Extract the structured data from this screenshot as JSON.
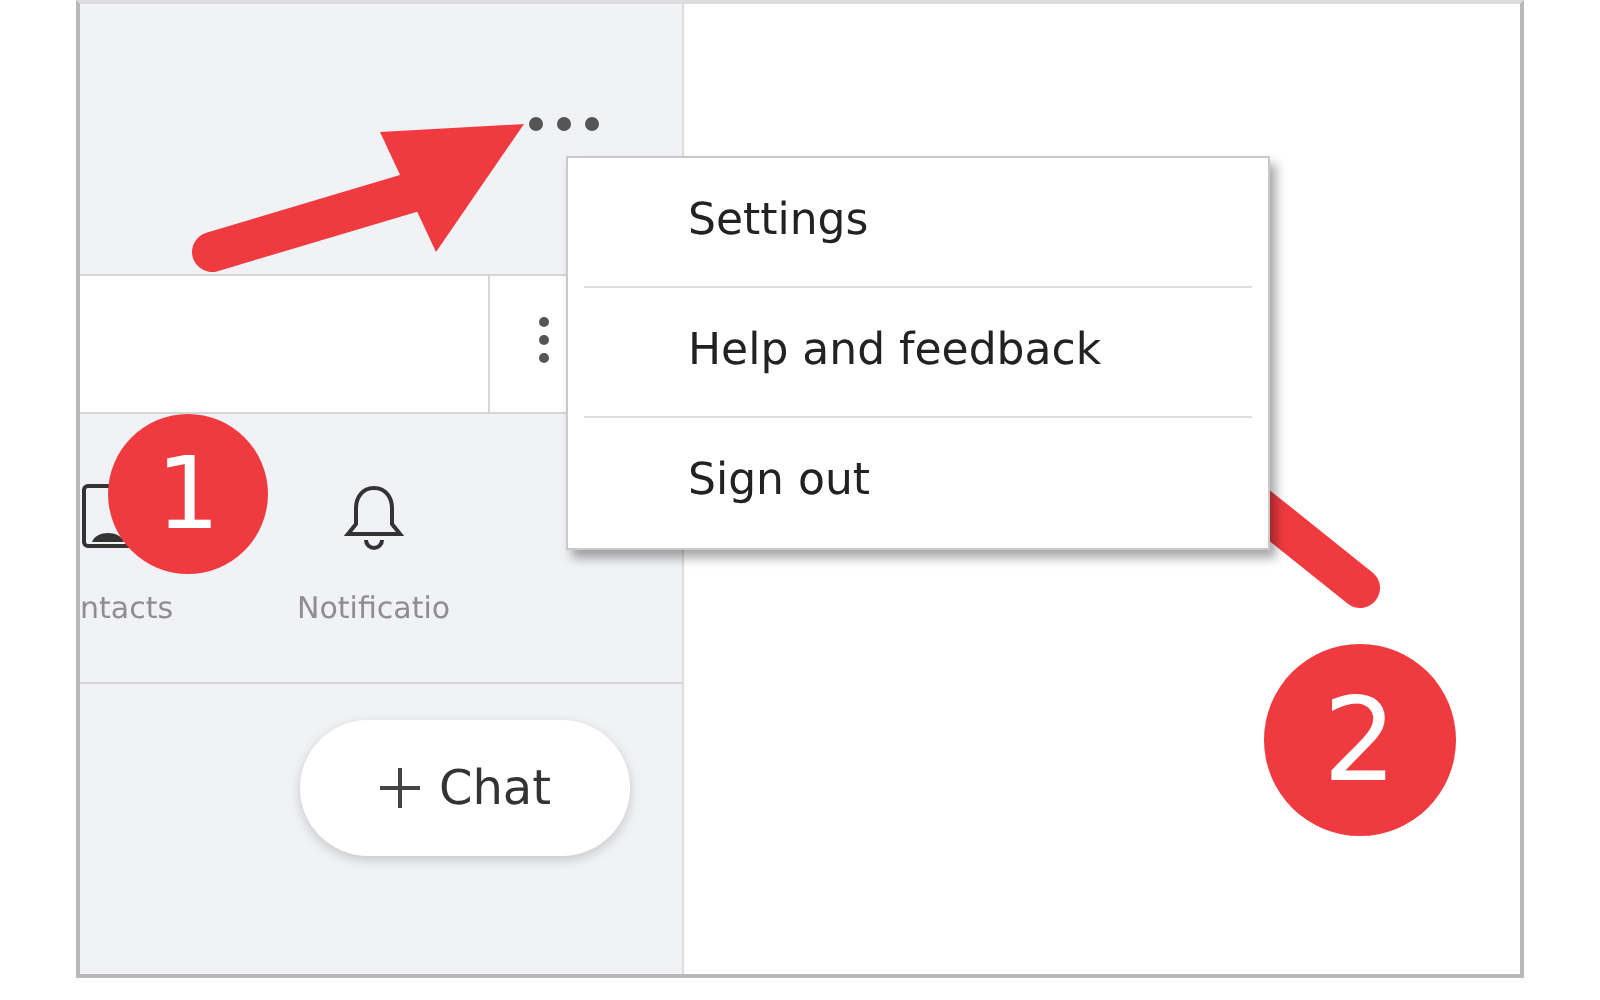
{
  "sidebar": {
    "nav_items": [
      {
        "label": "ntacts",
        "kind": "contacts"
      },
      {
        "label": "Notificatio",
        "kind": "bell"
      }
    ],
    "new_chat_button": {
      "label": "Chat"
    }
  },
  "menu": {
    "items": [
      {
        "label": "Settings"
      },
      {
        "label": "Help and feedback"
      },
      {
        "label": "Sign out"
      }
    ]
  },
  "callouts": [
    {
      "number": "1"
    },
    {
      "number": "2"
    }
  ]
}
